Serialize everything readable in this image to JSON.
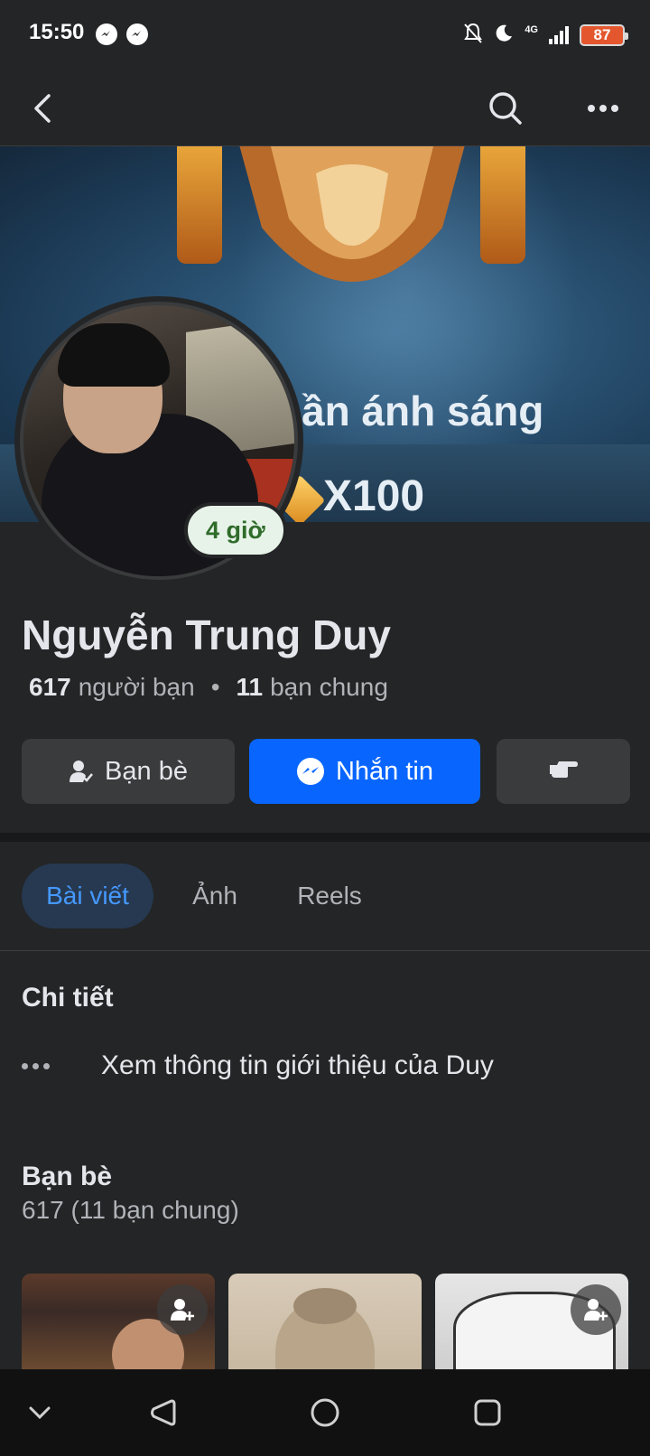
{
  "status_bar": {
    "time": "15:50",
    "network": "4G",
    "battery": "87",
    "icons": [
      "messenger-icon",
      "messenger-icon",
      "bell-off-icon",
      "moon-icon",
      "signal-icon",
      "battery-icon"
    ]
  },
  "app_bar": {
    "icons": [
      "back-arrow-icon",
      "search-icon",
      "more-icon"
    ]
  },
  "cover": {
    "text_line": "ần ánh sáng",
    "text_multiplier": "X100"
  },
  "profile": {
    "status_badge": "4 giờ",
    "name": "Nguyễn Trung Duy",
    "friends_count": "617",
    "friends_label": "người bạn",
    "separator": "•",
    "mutual_count": "11",
    "mutual_label": "bạn chung"
  },
  "actions": {
    "friends_label": "Bạn bè",
    "message_label": "Nhắn tin",
    "accent_color": "#0866ff"
  },
  "tabs": [
    {
      "label": "Bài viết",
      "active": true
    },
    {
      "label": "Ảnh",
      "active": false
    },
    {
      "label": "Reels",
      "active": false
    }
  ],
  "details": {
    "title": "Chi tiết",
    "intro_text": "Xem thông tin giới thiệu của Duy"
  },
  "friends_section": {
    "title": "Bạn bè",
    "summary": "617 (11 bạn chung)"
  },
  "nav_bar": {
    "icons": [
      "chevron-down-icon",
      "nav-back-icon",
      "nav-home-icon",
      "nav-recents-icon"
    ]
  }
}
